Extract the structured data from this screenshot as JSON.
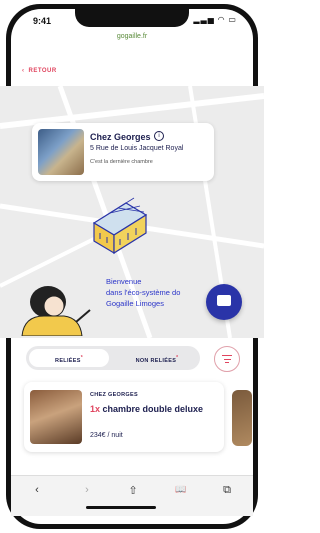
{
  "status_bar": {
    "time": "9:41",
    "icons": "▂▃▅ ◠ ▭"
  },
  "browser": {
    "url": "gogaille.fr"
  },
  "back_link": {
    "arrow": "‹",
    "label": "RETOUR"
  },
  "hotel_card": {
    "name": "Chez Georges",
    "info_icon": "i",
    "address": "5 Rue de Louis Jacquet Royal",
    "note": "C'est la dernière chambre"
  },
  "map": {
    "welcome_line1": "Bienvenue",
    "welcome_line2": "dans l'éco-système do",
    "welcome_line3": "Gogaille Limoges"
  },
  "toggle": {
    "linked_label": "RELIÉES",
    "linked_mark": "*",
    "unlinked_label": "NON RELIÉES",
    "unlinked_mark": "*"
  },
  "listing": {
    "hotel_name": "CHEZ GEORGES",
    "quantity": "1x",
    "room_type": "chambre double deluxe",
    "price": "234€ / nuit"
  },
  "toolbar": {
    "back": "‹",
    "forward": "›",
    "share": "⇧",
    "bookmarks": "📖",
    "tabs": "⧉"
  },
  "colors": {
    "accent_red": "#e0455f",
    "brand_navy": "#1d1f4f",
    "chat_blue": "#2a34a8"
  }
}
